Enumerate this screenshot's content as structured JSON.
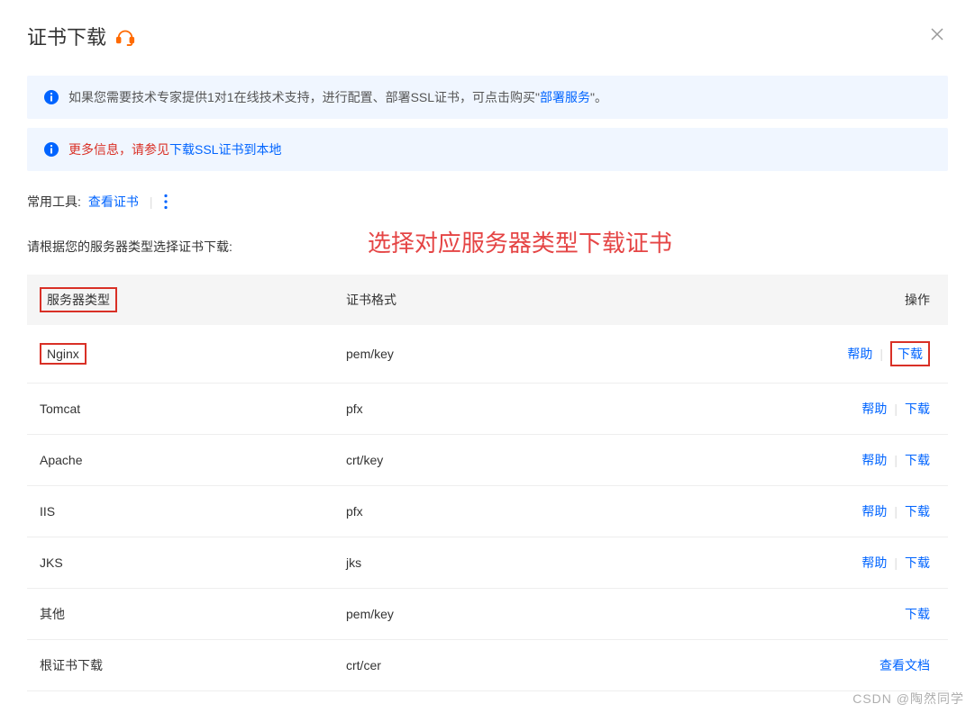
{
  "header": {
    "title": "证书下载"
  },
  "info1": {
    "prefix": "如果您需要技术专家提供1对1在线技术支持，进行配置、部署SSL证书，可点击购买\"",
    "link": "部署服务",
    "suffix": "\"。"
  },
  "info2": {
    "prefix": "更多信息，请参见",
    "link": "下载SSL证书到本地"
  },
  "tools": {
    "label": "常用工具:",
    "viewCert": "查看证书"
  },
  "instruction": "请根据您的服务器类型选择证书下载:",
  "annotation": "选择对应服务器类型下载证书",
  "table": {
    "headers": {
      "serverType": "服务器类型",
      "certFormat": "证书格式",
      "action": "操作"
    },
    "actions": {
      "help": "帮助",
      "download": "下载",
      "viewDoc": "查看文档"
    },
    "rows": [
      {
        "type": "Nginx",
        "format": "pem/key",
        "hasHelp": true,
        "dl": true,
        "hl": true
      },
      {
        "type": "Tomcat",
        "format": "pfx",
        "hasHelp": true,
        "dl": true
      },
      {
        "type": "Apache",
        "format": "crt/key",
        "hasHelp": true,
        "dl": true
      },
      {
        "type": "IIS",
        "format": "pfx",
        "hasHelp": true,
        "dl": true
      },
      {
        "type": "JKS",
        "format": "jks",
        "hasHelp": true,
        "dl": true
      },
      {
        "type": "其他",
        "format": "pem/key",
        "hasHelp": false,
        "dl": true
      },
      {
        "type": "根证书下载",
        "format": "crt/cer",
        "hasHelp": false,
        "doc": true
      }
    ]
  },
  "watermark": "CSDN @陶然同学"
}
